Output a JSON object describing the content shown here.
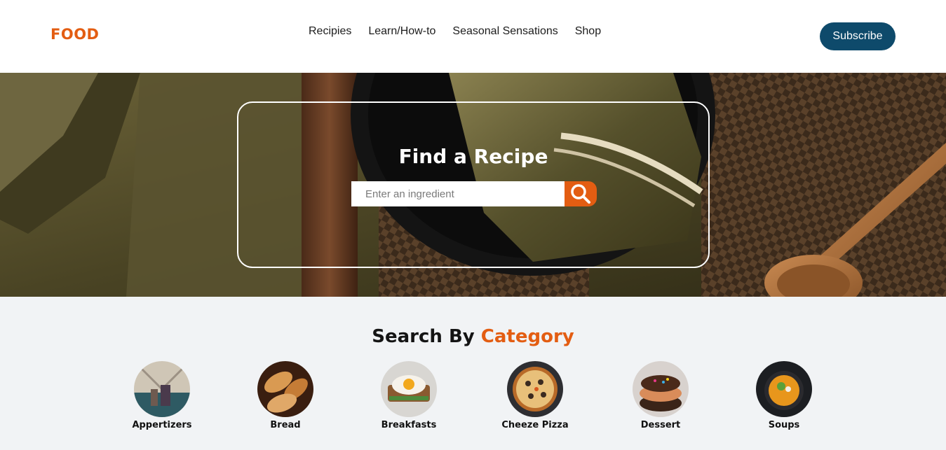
{
  "brand": {
    "logo": "FOOD",
    "accent": "#e35d12"
  },
  "nav": {
    "items": [
      "Recipies",
      "Learn/How-to",
      "Seasonal Sensations",
      "Shop"
    ]
  },
  "header": {
    "subscribe_label": "Subscribe",
    "subscribe_color": "#0e4a6b"
  },
  "hero": {
    "title": "Find a Recipe",
    "search_placeholder": "Enter an ingredient",
    "search_icon": "search-icon"
  },
  "category": {
    "title_prefix": "Search By",
    "title_accent": "Category",
    "items": [
      {
        "label": "Appertizers",
        "icon": "appetizers-image"
      },
      {
        "label": "Bread",
        "icon": "bread-image"
      },
      {
        "label": "Breakfasts",
        "icon": "breakfast-image"
      },
      {
        "label": "Cheeze Pizza",
        "icon": "pizza-image"
      },
      {
        "label": "Dessert",
        "icon": "dessert-image"
      },
      {
        "label": "Soups",
        "icon": "soup-image"
      }
    ]
  }
}
